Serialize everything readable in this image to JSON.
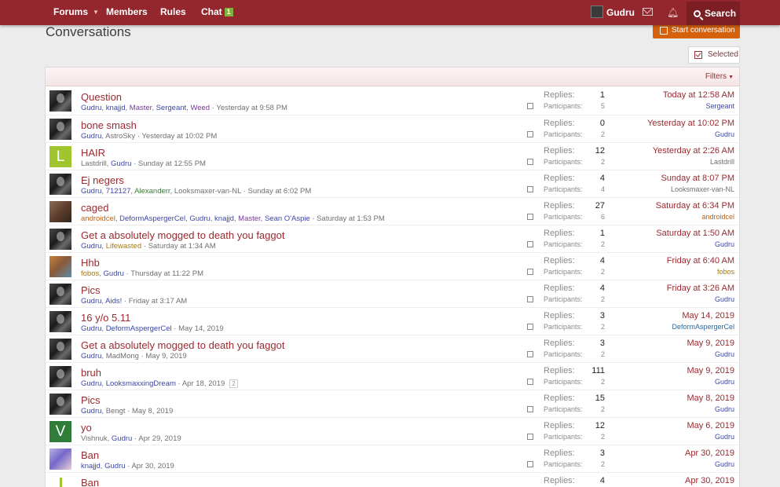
{
  "nav": {
    "forums_label": "Forums",
    "members_label": "Members",
    "rules_label": "Rules",
    "chat_label": "Chat",
    "chat_badge": "1",
    "username": "Gudru",
    "search_label": "Search"
  },
  "page": {
    "title": "Conversations",
    "start_conversation_label": "Start conversation",
    "selected_label": "Selected",
    "filters_label": "Filters"
  },
  "labels": {
    "replies": "Replies:",
    "participants": "Participants:"
  },
  "conversations": [
    {
      "avatar": "photo",
      "title": "Question",
      "participants": [
        {
          "name": "Gudru",
          "color": "blue"
        },
        {
          "name": "knajjd",
          "color": "blue"
        },
        {
          "name": "Master",
          "color": "purple"
        },
        {
          "name": "Sergeant",
          "color": "blue"
        },
        {
          "name": "Weed",
          "color": "purple"
        }
      ],
      "start_date": "Yesterday at 9:58 PM",
      "replies": "1",
      "participant_count": "5",
      "last_date": "Today at 12:58 AM",
      "last_user": "Sergeant",
      "last_user_color": "blue"
    },
    {
      "avatar": "photo",
      "title": "bone smash",
      "participants": [
        {
          "name": "Gudru",
          "color": "blue"
        },
        {
          "name": "AstroSky",
          "color": "gray"
        }
      ],
      "start_date": "Yesterday at 10:02 PM",
      "replies": "0",
      "participant_count": "2",
      "last_date": "Yesterday at 10:02 PM",
      "last_user": "Gudru",
      "last_user_color": "blue"
    },
    {
      "avatar": "letter-L",
      "title": "HAIR",
      "participants": [
        {
          "name": "Lastdrill",
          "color": "gray"
        },
        {
          "name": "Gudru",
          "color": "blue"
        }
      ],
      "start_date": "Sunday at 12:55 PM",
      "replies": "12",
      "participant_count": "2",
      "last_date": "Yesterday at 2:26 AM",
      "last_user": "Lastdrill",
      "last_user_color": "gray"
    },
    {
      "avatar": "photo",
      "title": "Ej negers",
      "participants": [
        {
          "name": "Gudru",
          "color": "blue"
        },
        {
          "name": "712127",
          "color": "blue"
        },
        {
          "name": "Alexanderr",
          "color": "green"
        },
        {
          "name": "Looksmaxer-van-NL",
          "color": "gray"
        }
      ],
      "start_date": "Sunday at 6:02 PM",
      "replies": "4",
      "participant_count": "4",
      "last_date": "Sunday at 8:07 PM",
      "last_user": "Looksmaxer-van-NL",
      "last_user_color": "gray"
    },
    {
      "avatar": "anime",
      "title": "caged",
      "participants": [
        {
          "name": "androidcel",
          "color": "orange"
        },
        {
          "name": "DeformAspergerCel",
          "color": "blue"
        },
        {
          "name": "Gudru",
          "color": "blue"
        },
        {
          "name": "knajjd",
          "color": "blue"
        },
        {
          "name": "Master",
          "color": "purple"
        },
        {
          "name": "Sean O'Aspie",
          "color": "blue"
        }
      ],
      "start_date": "Saturday at 1:53 PM",
      "replies": "27",
      "participant_count": "6",
      "last_date": "Saturday at 6:34 PM",
      "last_user": "androidcel",
      "last_user_color": "orange"
    },
    {
      "avatar": "photo",
      "title": "Get a absolutely mogged to death you faggot",
      "participants": [
        {
          "name": "Gudru",
          "color": "blue"
        },
        {
          "name": "Lifewasted",
          "color": "gold"
        }
      ],
      "start_date": "Saturday at 1:34 AM",
      "replies": "1",
      "participant_count": "2",
      "last_date": "Saturday at 1:50 AM",
      "last_user": "Gudru",
      "last_user_color": "blue"
    },
    {
      "avatar": "fobos",
      "title": "Hhb",
      "participants": [
        {
          "name": "fobos",
          "color": "gold"
        },
        {
          "name": "Gudru",
          "color": "blue"
        }
      ],
      "start_date": "Thursday at 11:22 PM",
      "replies": "4",
      "participant_count": "2",
      "last_date": "Friday at 6:40 AM",
      "last_user": "fobos",
      "last_user_color": "gold"
    },
    {
      "avatar": "photo",
      "title": "Pics",
      "participants": [
        {
          "name": "Gudru",
          "color": "blue"
        },
        {
          "name": "Aids!",
          "color": "blue"
        }
      ],
      "start_date": "Friday at 3:17 AM",
      "replies": "4",
      "participant_count": "2",
      "last_date": "Friday at 3:26 AM",
      "last_user": "Gudru",
      "last_user_color": "blue"
    },
    {
      "avatar": "photo",
      "title": "16 y/o 5.11",
      "participants": [
        {
          "name": "Gudru",
          "color": "blue"
        },
        {
          "name": "DeformAspergerCel",
          "color": "blue"
        }
      ],
      "start_date": "May 14, 2019",
      "replies": "3",
      "participant_count": "2",
      "last_date": "May 14, 2019",
      "last_user": "DeformAspergerCel",
      "last_user_color": "teal"
    },
    {
      "avatar": "photo",
      "title": "Get a absolutely mogged to death you faggot",
      "participants": [
        {
          "name": "Gudru",
          "color": "blue"
        },
        {
          "name": "MadMong",
          "color": "gray"
        }
      ],
      "start_date": "May 9, 2019",
      "replies": "3",
      "participant_count": "2",
      "last_date": "May 9, 2019",
      "last_user": "Gudru",
      "last_user_color": "blue"
    },
    {
      "avatar": "photo",
      "title": "bruh",
      "participants": [
        {
          "name": "Gudru",
          "color": "blue"
        },
        {
          "name": "LooksmaxxingDream",
          "color": "blue"
        }
      ],
      "start_date": "Apr 18, 2019",
      "page_chip": "2",
      "replies": "111",
      "participant_count": "2",
      "last_date": "May 9, 2019",
      "last_user": "Gudru",
      "last_user_color": "blue"
    },
    {
      "avatar": "photo",
      "title": "Pics",
      "participants": [
        {
          "name": "Gudru",
          "color": "blue"
        },
        {
          "name": "Bengt",
          "color": "gray"
        }
      ],
      "start_date": "May 8, 2019",
      "replies": "15",
      "participant_count": "2",
      "last_date": "May 8, 2019",
      "last_user": "Gudru",
      "last_user_color": "blue"
    },
    {
      "avatar": "letter-V",
      "title": "yo",
      "participants": [
        {
          "name": "Vishnuk",
          "color": "gray"
        },
        {
          "name": "Gudru",
          "color": "blue"
        }
      ],
      "start_date": "Apr 29, 2019",
      "replies": "12",
      "participant_count": "2",
      "last_date": "May 6, 2019",
      "last_user": "Gudru",
      "last_user_color": "blue"
    },
    {
      "avatar": "knajjd",
      "title": "Ban",
      "participants": [
        {
          "name": "knajjd",
          "color": "blue"
        },
        {
          "name": "Gudru",
          "color": "blue"
        }
      ],
      "start_date": "Apr 30, 2019",
      "replies": "3",
      "participant_count": "2",
      "last_date": "Apr 30, 2019",
      "last_user": "Gudru",
      "last_user_color": "blue"
    },
    {
      "avatar": "letter-L-partial",
      "title": "Ban",
      "participants": [],
      "start_date": "",
      "replies": "4",
      "participant_count": "",
      "last_date": "Apr 30, 2019",
      "last_user": "",
      "last_user_color": "blue"
    }
  ]
}
